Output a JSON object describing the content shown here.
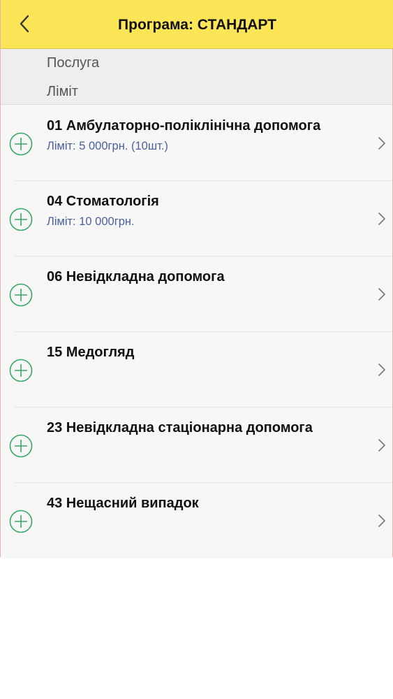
{
  "header": {
    "title": "Програма: СТАНДАРТ"
  },
  "columns": {
    "service_label": "Послуга",
    "limit_label": "Ліміт"
  },
  "services": [
    {
      "title": "01 Амбулаторно-поліклінічна допомога",
      "limit": "Ліміт: 5 000грн. (10шт.)"
    },
    {
      "title": "04 Стоматологія",
      "limit": "Ліміт: 10 000грн."
    },
    {
      "title": "06 Невідкладна допомога",
      "limit": ""
    },
    {
      "title": "15 Медогляд",
      "limit": ""
    },
    {
      "title": "23 Невідкладна стаціонарна допомога",
      "limit": ""
    },
    {
      "title": "43 Нещасний випадок",
      "limit": ""
    }
  ],
  "colors": {
    "header_bg": "#fce557",
    "accent_green": "#3aa866",
    "limit_text": "#4a5f9e"
  },
  "icons": {
    "back": "chevron-left-icon",
    "add": "plus-circle-icon",
    "detail": "chevron-right-icon"
  }
}
